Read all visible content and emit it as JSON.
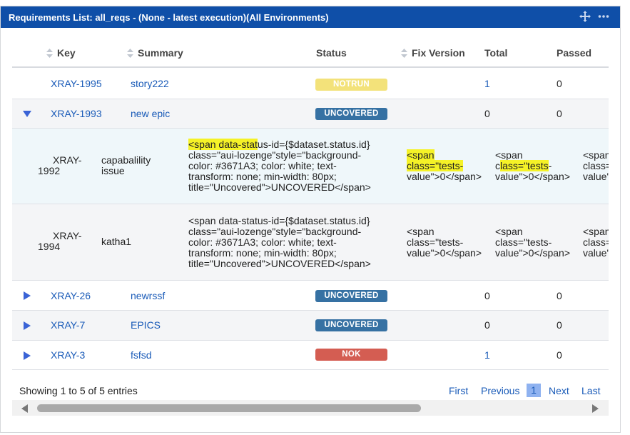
{
  "panel": {
    "title": "Requirements List: all_reqs - (None - latest execution)(All Environments)",
    "move_icon": "move-icon",
    "more_icon": "more-icon"
  },
  "columns": {
    "key": "Key",
    "summary": "Summary",
    "status": "Status",
    "fix_version": "Fix Version",
    "total": "Total",
    "passed": "Passed"
  },
  "rows": [
    {
      "key": "XRAY-1995",
      "summary": "story222",
      "status": "NOTRUN",
      "total": "1",
      "passed": "0"
    },
    {
      "key": "XRAY-1993",
      "summary": "new epic",
      "status": "UNCOVERED",
      "total": "0",
      "passed": "0"
    },
    {
      "key_line1": "XRAY-",
      "key_line2": "1992",
      "summary_line1": "capabalility",
      "summary_line2": "issue",
      "status_l1_hl": "<span data-stat",
      "status_l1_rest": "us-id={$dataset.status.id}",
      "status_l2": "class=\"aui-lozenge\"style=\"background-",
      "status_l3": "color: #3671A3; color: white; text-",
      "status_l4": "transform: none; min-width: 80px;",
      "status_l5": "title=\"Uncovered\">UNCOVERED</span>",
      "fix_l1": "<span",
      "fix_l2_hl": "class=\"tests-",
      "fix_l3": "value\">0</span>",
      "total_l1": "<span",
      "total_l2_pre": "c",
      "total_l2_hl": "lass=\"tests",
      "total_l2_post": "-",
      "total_l3": "value\">0</span>",
      "passed_l1": "<span",
      "passed_l2": "class=",
      "passed_l3": "value\""
    },
    {
      "key_line1": "XRAY-",
      "key_line2": "1994",
      "summary": "katha1",
      "status_l1": "<span data-status-id={$dataset.status.id}",
      "status_l2": "class=\"aui-lozenge\"style=\"background-",
      "status_l3": "color: #3671A3; color: white; text-",
      "status_l4": "transform: none; min-width: 80px;",
      "status_l5": "title=\"Uncovered\">UNCOVERED</span>",
      "fix_l1": "<span",
      "fix_l2": "class=\"tests-",
      "fix_l3": "value\">0</span>",
      "total_l1": "<span",
      "total_l2": "class=\"tests-",
      "total_l3": "value\">0</span>",
      "passed_l1": "<span",
      "passed_l2": "class=",
      "passed_l3": "value\""
    },
    {
      "key": "XRAY-26",
      "summary": "newrssf",
      "status": "UNCOVERED",
      "total": "0",
      "passed": "0"
    },
    {
      "key": "XRAY-7",
      "summary": "EPICS",
      "status": "UNCOVERED",
      "total": "0",
      "passed": "0"
    },
    {
      "key": "XRAY-3",
      "summary": "fsfsd",
      "status": "NOK",
      "total": "1",
      "passed": "0"
    }
  ],
  "footer": {
    "info": "Showing 1 to 5 of 5 entries",
    "first": "First",
    "previous": "Previous",
    "current_page": "1",
    "next": "Next",
    "last": "Last"
  },
  "colors": {
    "header_bg": "#0f4fa8",
    "notrun": "#f3e27a",
    "uncovered": "#3671a3",
    "nok": "#d45d52",
    "link": "#1a5bb8",
    "highlight": "#f5f227"
  }
}
